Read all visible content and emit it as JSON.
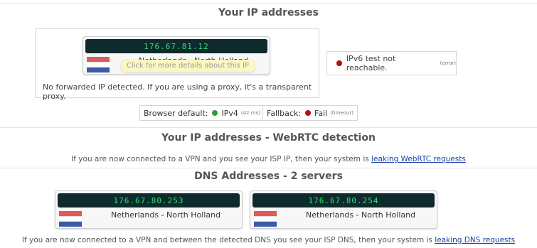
{
  "ip_section": {
    "title": "Your IP addresses",
    "ip": "176.67.81.12",
    "location": "Netherlands - North Holland",
    "tooltip": "Click for more details about this IP",
    "forward_note": "No forwarded IP detected. If you are using a proxy, it's a transparent proxy.",
    "ipv6_text": "IPv6 test not reachable.",
    "ipv6_status": "(error)",
    "browser_default_label": "Browser default:",
    "browser_default_value": "IPv4",
    "browser_default_time": "(42 ms)",
    "fallback_label": "Fallback:",
    "fallback_value": "Fail",
    "fallback_status": "(timeout)"
  },
  "webrtc": {
    "title": "Your IP addresses - WebRTC detection",
    "text": "If you are now connected to a VPN and you see your ISP IP, then your system is",
    "link": "leaking WebRTC requests"
  },
  "dns": {
    "title": "DNS Addresses - 2 servers",
    "servers": [
      {
        "ip": "176.67.80.253",
        "location": "Netherlands - North Holland"
      },
      {
        "ip": "176.67.80.254",
        "location": "Netherlands - North Holland"
      }
    ],
    "text": "If you are now connected to a VPN and between the detected DNS you see your ISP DNS, then your system is",
    "link": "leaking DNS requests"
  },
  "colors": {
    "ip_bar_bg": "#0e2a2c",
    "ip_text": "#35e07a",
    "flag_red": "#e05a5a",
    "flag_blue": "#3b5aa8",
    "status_red": "#b30d0d",
    "status_green": "#2e9c2e"
  },
  "icons": {
    "flag": "netherlands-flag-icon",
    "error_dot": "red-dot-icon",
    "ok_dot": "green-dot-icon"
  }
}
